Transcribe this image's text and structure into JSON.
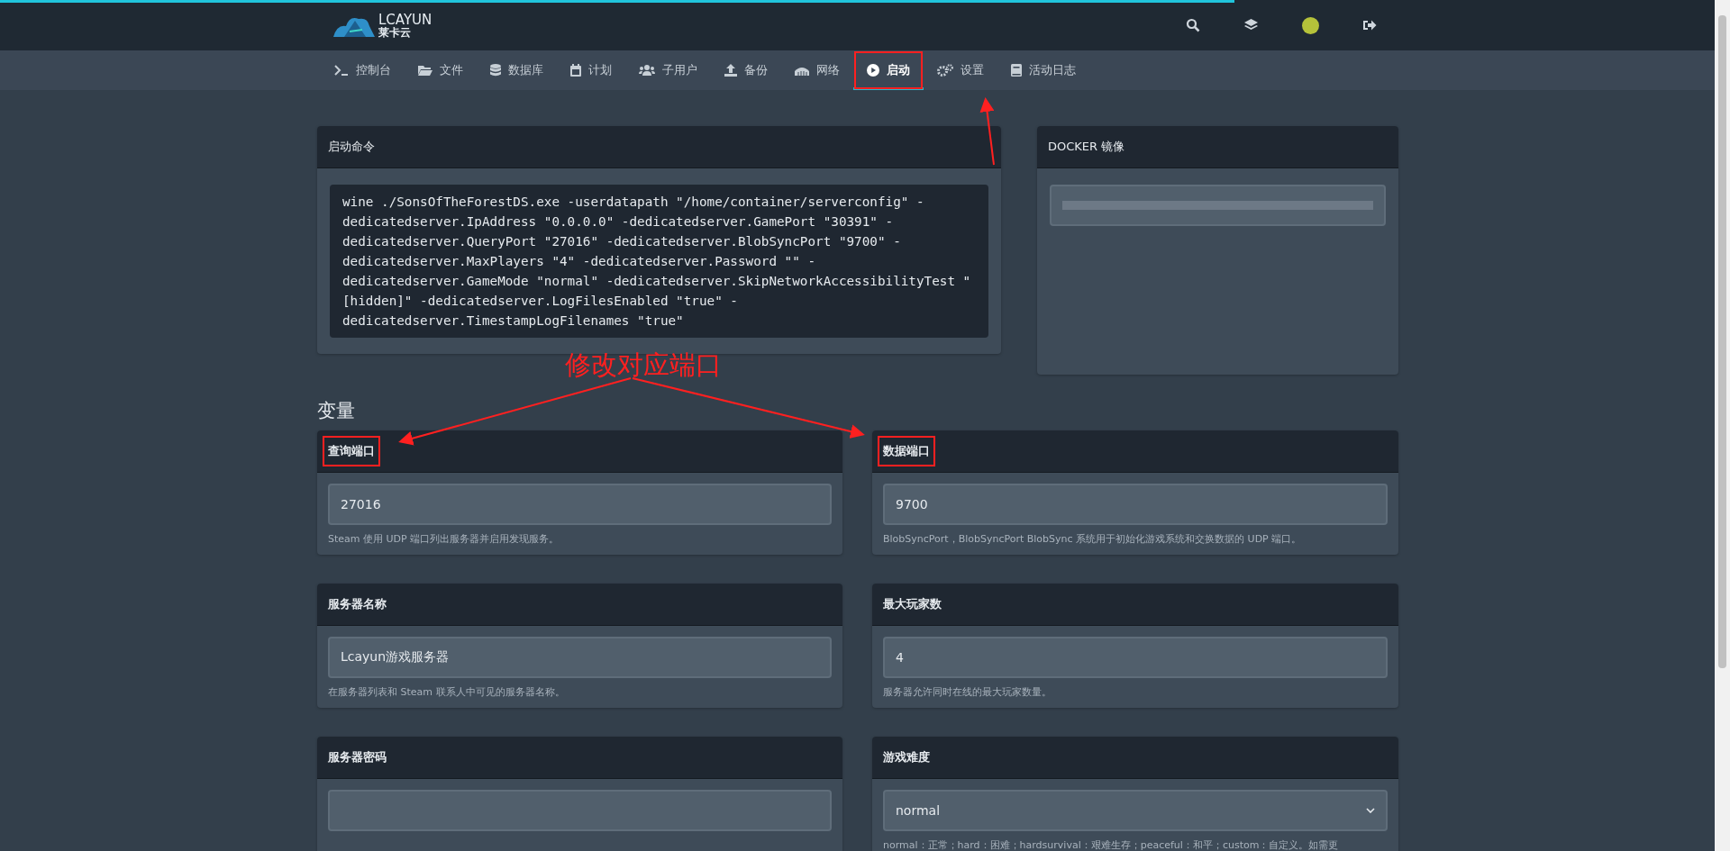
{
  "header": {
    "logo_latin": "LCAYUN",
    "logo_cjk": "莱卡云"
  },
  "nav": [
    {
      "label": "控制台",
      "selected": false,
      "marked": false
    },
    {
      "label": "文件",
      "selected": false,
      "marked": false
    },
    {
      "label": "数据库",
      "selected": false,
      "marked": false
    },
    {
      "label": "计划",
      "selected": false,
      "marked": false
    },
    {
      "label": "子用户",
      "selected": false,
      "marked": false
    },
    {
      "label": "备份",
      "selected": false,
      "marked": false
    },
    {
      "label": "网络",
      "selected": false,
      "marked": false
    },
    {
      "label": "启动",
      "selected": true,
      "marked": true
    },
    {
      "label": "设置",
      "selected": false,
      "marked": false
    },
    {
      "label": "活动日志",
      "selected": false,
      "marked": false
    }
  ],
  "startup": {
    "title": "启动命令",
    "command": "wine ./SonsOfTheForestDS.exe -userdatapath \"/home/container/serverconfig\" -dedicatedserver.IpAddress \"0.0.0.0\" -dedicatedserver.GamePort \"30391\" -dedicatedserver.QueryPort \"27016\" -dedicatedserver.BlobSyncPort \"9700\" -dedicatedserver.MaxPlayers \"4\" -dedicatedserver.Password \"\" -dedicatedserver.GameMode \"normal\" -dedicatedserver.SkipNetworkAccessibilityTest \"[hidden]\" -dedicatedserver.LogFilesEnabled \"true\" -dedicatedserver.TimestampLogFilenames \"true\""
  },
  "docker": {
    "title": "DOCKER 镜像"
  },
  "annotation": {
    "text": "修改对应端口"
  },
  "variables_title": "变量",
  "variables": [
    {
      "label": "查询端口",
      "kind": "text",
      "value": "27016",
      "help": "Steam 使用 UDP 端口列出服务器并启用发现服务。",
      "marked": true
    },
    {
      "label": "数据端口",
      "kind": "text",
      "value": "9700",
      "help": "BlobSyncPort，BlobSyncPort BlobSync 系统用于初始化游戏系统和交换数据的 UDP 端口。",
      "marked": true
    },
    {
      "label": "服务器名称",
      "kind": "text",
      "value": "Lcayun游戏服务器",
      "help": "在服务器列表和 Steam 联系人中可见的服务器名称。",
      "marked": false
    },
    {
      "label": "最大玩家数",
      "kind": "text",
      "value": "4",
      "help": "服务器允许同时在线的最大玩家数量。",
      "marked": false
    },
    {
      "label": "服务器密码",
      "kind": "text",
      "marked": false
    },
    {
      "label": "游戏难度",
      "kind": "select",
      "value": "normal",
      "help": "normal：正常；hard：困难；hardsurvival：艰难生存；peaceful：和平；custom：自定义。如需更",
      "marked": false
    }
  ]
}
